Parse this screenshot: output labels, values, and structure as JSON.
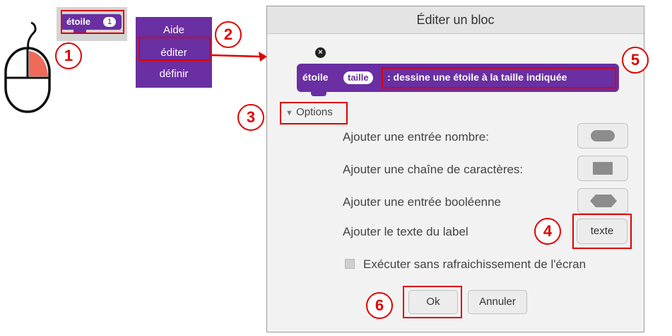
{
  "mini_block": {
    "name": "étoile",
    "slot": "1"
  },
  "context_menu": {
    "items": [
      "Aide",
      "éditer",
      "définir"
    ]
  },
  "steps": [
    "1",
    "2",
    "3",
    "4",
    "5",
    "6"
  ],
  "dialog": {
    "title": "Éditer un bloc",
    "close": "×",
    "block": {
      "name": "étoile",
      "param": "taille",
      "label": ": dessine une étoile à la taille indiquée"
    },
    "options_label": "Options",
    "rows": [
      "Ajouter une entrée nombre:",
      "Ajouter une chaîne de caractères:",
      "Ajouter une entrée booléenne",
      "Ajouter le texte du label"
    ],
    "text_button": "texte",
    "warp_label": "Exécuter sans rafraichissement de l'écran",
    "ok": "Ok",
    "cancel": "Annuler"
  },
  "colors": {
    "block": "#6a2fa2",
    "annotation": "#e00000",
    "mouse_button": "#f06a5a"
  },
  "icons": [
    "mouse-icon",
    "arrow-right-icon",
    "triangle-down-icon",
    "rounded-slot-icon",
    "rectangle-slot-icon",
    "hexagon-slot-icon"
  ]
}
